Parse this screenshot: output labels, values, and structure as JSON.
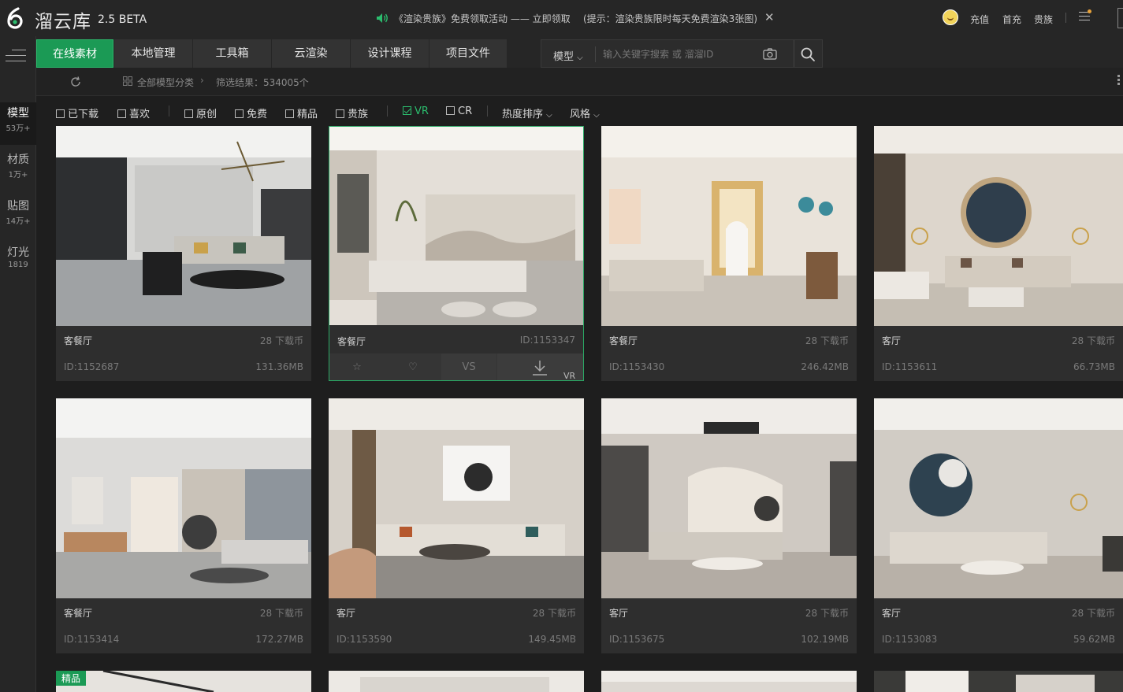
{
  "app": {
    "title": "溜云库",
    "version": "2.5 BETA",
    "promo_text": "《渲染贵族》免费领取活动 —— 立即领取",
    "promo_hint": "(提示：渲染贵族限时每天免费渲染3张图)",
    "top_links": [
      "充值",
      "首充",
      "贵族"
    ]
  },
  "rail": [
    {
      "label": "模型",
      "count": "53万+"
    },
    {
      "label": "材质",
      "count": "1万+"
    },
    {
      "label": "贴图",
      "count": "14万+"
    },
    {
      "label": "灯光",
      "count": "1819"
    }
  ],
  "tabs": [
    "在线素材",
    "本地管理",
    "工具箱",
    "云渲染",
    "设计课程",
    "项目文件"
  ],
  "search": {
    "type": "模型",
    "placeholder": "输入关键字搜索 或 溜溜ID"
  },
  "breadcrumb": {
    "all": "全部模型分类",
    "result": "筛选结果：534005个"
  },
  "filters": [
    "已下载",
    "喜欢",
    "原创",
    "免费",
    "精品",
    "贵族",
    "VR",
    "CR"
  ],
  "filters_checked": [
    "VR"
  ],
  "sort": [
    "热度排序",
    "风格"
  ],
  "card_actions": {
    "compare": "VS",
    "vr": "VR"
  },
  "cards": [
    {
      "category": "客餐厅",
      "price": "28 下载币",
      "id": "ID:1152687",
      "size": "131.36MB"
    },
    {
      "category": "客餐厅",
      "price": "ID:1153347",
      "id": "",
      "size": ""
    },
    {
      "category": "客餐厅",
      "price": "28 下载币",
      "id": "ID:1153430",
      "size": "246.42MB"
    },
    {
      "category": "客厅",
      "price": "28 下载币",
      "id": "ID:1153611",
      "size": "66.73MB"
    },
    {
      "category": "客餐厅",
      "price": "28 下载币",
      "id": "ID:1153414",
      "size": "172.27MB"
    },
    {
      "category": "客厅",
      "price": "28 下载币",
      "id": "ID:1153590",
      "size": "149.45MB"
    },
    {
      "category": "客厅",
      "price": "28 下载币",
      "id": "ID:1153675",
      "size": "102.19MB"
    },
    {
      "category": "客厅",
      "price": "28 下载币",
      "id": "ID:1153083",
      "size": "59.62MB"
    },
    {
      "badge": "精品"
    }
  ],
  "colors": {
    "accent": "#1b9a55",
    "accent_text": "#2bbd6e",
    "background": "#1e1e1e",
    "card": "#2e2e2e"
  }
}
